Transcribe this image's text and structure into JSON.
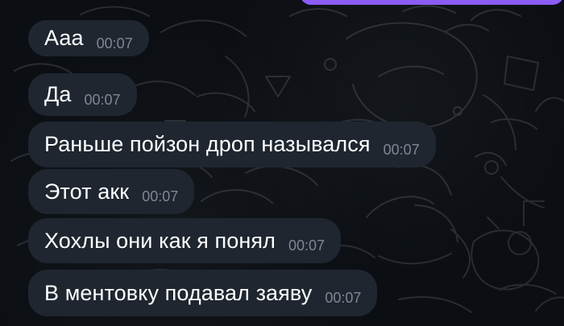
{
  "messages": [
    {
      "text": "Ааа",
      "time": "00:07"
    },
    {
      "text": "Да",
      "time": "00:07"
    },
    {
      "text": "Раньше пойзон дроп назывался",
      "time": "00:07"
    },
    {
      "text": "Этот акк",
      "time": "00:07"
    },
    {
      "text": "Хохлы они как я понял",
      "time": "00:07"
    },
    {
      "text": "В ментовку подавал заяву",
      "time": "00:07"
    }
  ],
  "colors": {
    "background": "#0b0f14",
    "bubble": "#1f2630",
    "outgoing_bubble": "#8b5cf6",
    "text": "#ffffff",
    "timestamp": "#7e8792"
  }
}
